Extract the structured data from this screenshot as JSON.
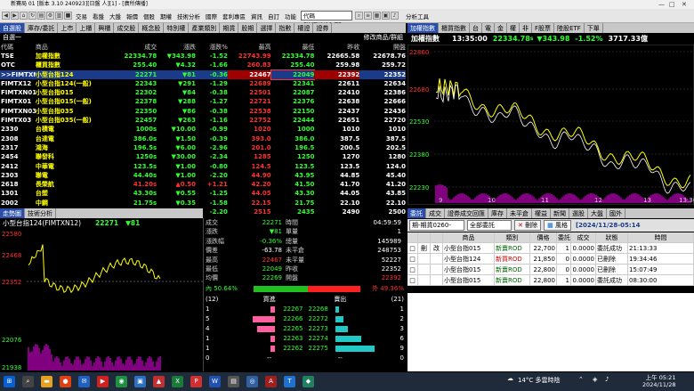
{
  "window": {
    "title": "新賽局 01 [版本 3.10 240923][日盤 人][1] - [廣所傳播]"
  },
  "toolbar": {
    "menus": [
      "交易",
      "看盤",
      "大盤",
      "報價",
      "個股",
      "期權",
      "技術分析",
      "國際",
      "套利專區",
      "資訊",
      "自訂",
      "功能"
    ],
    "code": "代碼 FIMTXN12.TF",
    "tech_tool": "分析工具"
  },
  "quote_panel": {
    "tabs": [
      "自選股",
      "庫存/委託",
      "上市",
      "上櫃",
      "興櫃",
      "成交股",
      "概念股",
      "特別權",
      "產業類別",
      "期貨",
      "股期",
      "選擇",
      "指數",
      "權證",
      "證券"
    ],
    "group_name": "自選一",
    "edit_label": "修改商品/群組",
    "headers": [
      "代碼",
      "商品",
      "成交",
      "漲跌",
      "漲跌%",
      "最高",
      "最低",
      "昨收",
      "開盤"
    ],
    "rows": [
      {
        "code": "TSE",
        "name": "加權指數",
        "price": "22334.78",
        "change": "▼343.98",
        "pct": "-1.52",
        "high": "22743.99",
        "low": "22334.78",
        "prev": "22665.58",
        "open": "22678.76",
        "dir": "dn"
      },
      {
        "code": "OTC",
        "name": "櫃買指數",
        "price": "255.40",
        "change": "▼4.32",
        "pct": "-1.66",
        "high": "260.83",
        "low": "255.40",
        "prev": "259.98",
        "open": "259.72",
        "dir": "dn"
      },
      {
        "code": ">>FIMTXN12",
        "name": "小型台指124",
        "price": "22271",
        "change": "▼81",
        "pct": "-0.36",
        "high": "22467",
        "low": "22049",
        "prev": "22392",
        "open": "22352",
        "dir": "dn"
      },
      {
        "code": "FIMTX12",
        "name": "小型台指124(一般)",
        "price": "22343",
        "change": "▼291",
        "pct": "-1.29",
        "high": "22689",
        "low": "22341",
        "prev": "22611",
        "open": "22634",
        "dir": "dn"
      },
      {
        "code": "FIMTXN01",
        "name": "小型台指015",
        "price": "22302",
        "change": "▼84",
        "pct": "-0.38",
        "high": "22501",
        "low": "22087",
        "prev": "22410",
        "open": "22386",
        "dir": "dn"
      },
      {
        "code": "FIMTX01",
        "name": "小型台指015(一般)",
        "price": "22378",
        "change": "▼288",
        "pct": "-1.27",
        "high": "22721",
        "low": "22376",
        "prev": "22638",
        "open": "22666",
        "dir": "dn"
      },
      {
        "code": "FIMTXN03",
        "name": "小型台指035",
        "price": "22350",
        "change": "▼86",
        "pct": "-0.38",
        "high": "22538",
        "low": "22150",
        "prev": "22437",
        "open": "22436",
        "dir": "dn"
      },
      {
        "code": "FIMTX03",
        "name": "小型台指035(一般)",
        "price": "22457",
        "change": "▼263",
        "pct": "-1.16",
        "high": "22752",
        "low": "22444",
        "prev": "22651",
        "open": "22720",
        "dir": "dn"
      },
      {
        "code": "2330",
        "name": "台積電",
        "price": "1000s",
        "change": "▼10.00",
        "pct": "-0.99",
        "high": "1020",
        "low": "1000",
        "prev": "1010",
        "open": "1010",
        "dir": "dn"
      },
      {
        "code": "2308",
        "name": "台達電",
        "price": "386.0s",
        "change": "▼1.50",
        "pct": "-0.39",
        "high": "393.0",
        "low": "386.0",
        "prev": "387.5",
        "open": "387.5",
        "dir": "dn"
      },
      {
        "code": "2317",
        "name": "鴻海",
        "price": "196.5s",
        "change": "▼6.00",
        "pct": "-2.96",
        "high": "201.0",
        "low": "196.5",
        "prev": "200.5",
        "open": "202.5",
        "dir": "dn"
      },
      {
        "code": "2454",
        "name": "聯發科",
        "price": "1250s",
        "change": "▼30.00",
        "pct": "-2.34",
        "high": "1285",
        "low": "1250",
        "prev": "1270",
        "open": "1280",
        "dir": "dn"
      },
      {
        "code": "2412",
        "name": "中華電",
        "price": "123.5s",
        "change": "▼1.00",
        "pct": "-0.80",
        "high": "124.5",
        "low": "123.5",
        "prev": "123.5",
        "open": "124.0",
        "dir": "dn"
      },
      {
        "code": "2303",
        "name": "聯電",
        "price": "44.40s",
        "change": "▼1.00",
        "pct": "-2.20",
        "high": "44.90",
        "low": "43.95",
        "prev": "44.85",
        "open": "45.40",
        "dir": "dn"
      },
      {
        "code": "2618",
        "name": "長榮航",
        "price": "41.20s",
        "change": "▲0.50",
        "pct": "+1.21",
        "high": "42.20",
        "low": "41.50",
        "prev": "41.70",
        "open": "41.20",
        "dir": "up"
      },
      {
        "code": "1301",
        "name": "台塑",
        "price": "43.30s",
        "change": "▼0.55",
        "pct": "-1.25",
        "high": "44.05",
        "low": "43.30",
        "prev": "44.05",
        "open": "43.85",
        "dir": "dn"
      },
      {
        "code": "2002",
        "name": "中鋼",
        "price": "21.75s",
        "change": "▼0.35",
        "pct": "-1.58",
        "high": "22.15",
        "low": "21.75",
        "prev": "22.10",
        "open": "22.10",
        "dir": "dn"
      },
      {
        "code": "3008",
        "name": "大立光",
        "price": "2445s",
        "change": "▼55.00",
        "pct": "-2.20",
        "high": "2515",
        "low": "2435",
        "prev": "2490",
        "open": "2500",
        "dir": "dn"
      }
    ]
  },
  "index_chart": {
    "tabs": [
      "加權指數",
      "櫃買指數",
      "台",
      "電",
      "金",
      "權",
      "非",
      "F股票",
      "陸股ETF",
      "下單"
    ],
    "name": "加權指數",
    "time": "13:35:00",
    "price": "22334.78",
    "unit": "s",
    "change": "▼343.98",
    "pct": "-1.52%",
    "volume": "3717.33億",
    "y_ticks": [
      "22860",
      "22680",
      "22530",
      "22380",
      "22230"
    ],
    "x_ticks": [
      "9",
      "10",
      "11",
      "12",
      "13",
      "13:30"
    ]
  },
  "fut_panel": {
    "tabs": [
      "走勢圖",
      "技術分析"
    ],
    "name": "小型台指124(FIMTXN12)",
    "price": "22271",
    "change": "▼81",
    "y_ticks": [
      "22580",
      "22468",
      "22352",
      "22076",
      "21938"
    ],
    "current_price_label": "22352",
    "info": [
      [
        "成交",
        "22271",
        "時間",
        "04:59:59"
      ],
      [
        "漲跌",
        "▼81",
        "單量",
        "1"
      ],
      [
        "漲跌幅",
        "-0.36%",
        "總量",
        "145989"
      ],
      [
        "價差",
        "-63.78",
        "未平倉",
        "248753"
      ],
      [
        "最高",
        "22467",
        "未平量",
        "52227"
      ],
      [
        "最低",
        "22049",
        "昨收",
        "22352"
      ],
      [
        "均價",
        "22269",
        "開盤",
        "22392"
      ]
    ],
    "inner_pct": "內 50.64%",
    "outer_pct": "外 49.36%",
    "inner_fraction": 0.5064,
    "book_headers": [
      "(12)",
      "買進",
      "賣出",
      "(21)"
    ],
    "book": [
      {
        "bid_qty": "1",
        "bid": "22267",
        "ask": "22268",
        "ask_qty": "1"
      },
      {
        "bid_qty": "5",
        "bid": "22266",
        "ask": "22272",
        "ask_qty": "2"
      },
      {
        "bid_qty": "4",
        "bid": "22265",
        "ask": "22273",
        "ask_qty": "3"
      },
      {
        "bid_qty": "1",
        "bid": "22263",
        "ask": "22274",
        "ask_qty": "6"
      },
      {
        "bid_qty": "1",
        "bid": "22262",
        "ask": "22275",
        "ask_qty": "9"
      }
    ],
    "book_footer": [
      "0",
      "--",
      "--",
      "0"
    ]
  },
  "order_panel": {
    "tabs": [
      "委託",
      "成交",
      "證券成交回匯",
      "庫存",
      "未平倉",
      "權益",
      "新聞",
      "選股",
      "大盤",
      "國外"
    ],
    "account": "期-期貨0260-",
    "filter": "全部委託",
    "delete_btn": "刪除",
    "style_btn": "風格",
    "date": "[2024/11/28-05:14",
    "headers": [
      "",
      "",
      "",
      "商品",
      "類別",
      "價格",
      "委託",
      "成交",
      "狀態",
      "時間"
    ],
    "rows": [
      {
        "op": "刪",
        "op2": "改",
        "name": "小型台指015",
        "type": "新賣ROD",
        "price": "22,700",
        "qty": "1",
        "fill": "0.0000",
        "status": "委託成功",
        "time": "21:13:33"
      },
      {
        "op": "",
        "op2": "",
        "name": "小型台指124",
        "type": "新買ROD",
        "price": "21,850",
        "qty": "0",
        "fill": "0.0000",
        "status": "已刪除",
        "time": "19:34:46"
      },
      {
        "op": "",
        "op2": "",
        "name": "小型台指015",
        "type": "新賣ROD",
        "price": "22,800",
        "qty": "0",
        "fill": "0.0000",
        "status": "已刪除",
        "time": "15:07:49"
      },
      {
        "op": "",
        "op2": "",
        "name": "小型台指015",
        "type": "新賣ROD",
        "price": "22,800",
        "qty": "1",
        "fill": "0.0000",
        "status": "委託成功",
        "time": "08:30:00"
      }
    ]
  },
  "taskbar": {
    "weather": "14°C 多雲時陰",
    "time": "上午 05:21",
    "date": "2024/11/28"
  },
  "colors": {
    "up": "#ff3030",
    "down": "#30ff30",
    "accent": "#2a4ea8",
    "price_line": "#ffff00",
    "volume": "#ff00ff"
  }
}
